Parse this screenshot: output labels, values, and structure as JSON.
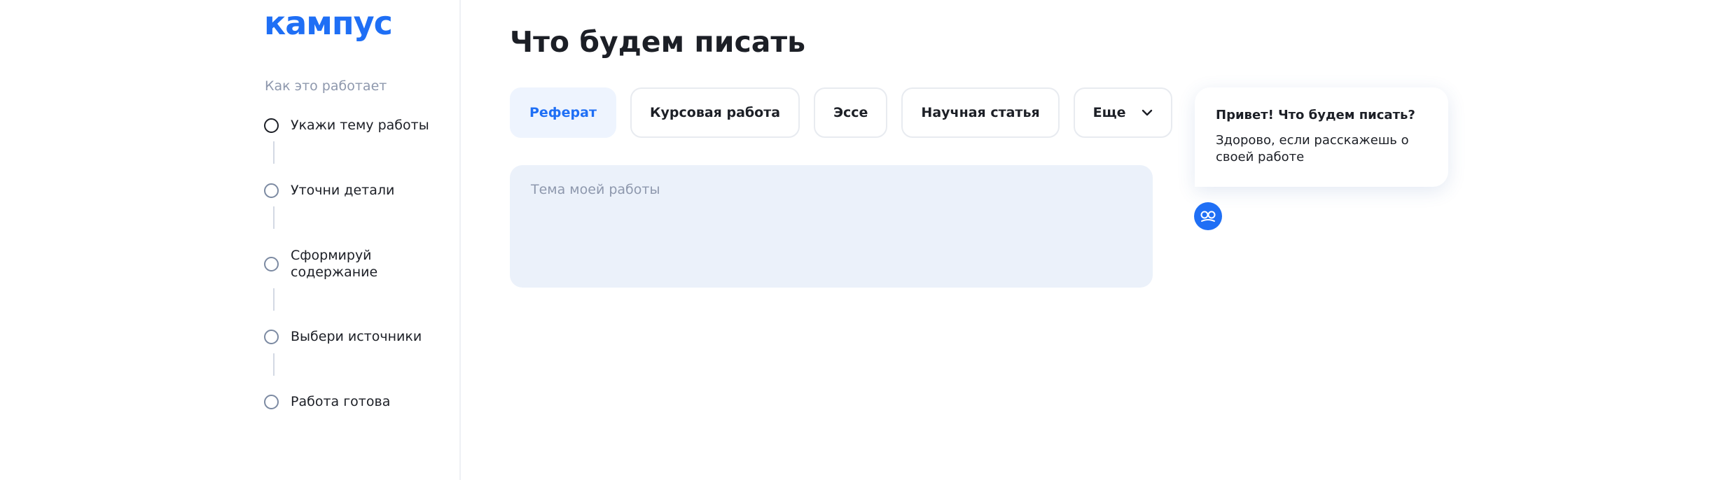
{
  "brand": {
    "logo_text": "кампус",
    "color": "#1f6ff5"
  },
  "sidebar": {
    "how_it_works_title": "Как это работает",
    "steps": [
      {
        "label": "Укажи тему работы",
        "active": true
      },
      {
        "label": "Уточни детали",
        "active": false
      },
      {
        "label": "Сформируй содержание",
        "active": false
      },
      {
        "label": "Выбери источники",
        "active": false
      },
      {
        "label": "Работа готова",
        "active": false
      }
    ]
  },
  "main": {
    "title": "Что будем писать",
    "tabs": [
      {
        "label": "Реферат",
        "selected": true
      },
      {
        "label": "Курсовая работа",
        "selected": false
      },
      {
        "label": "Эссе",
        "selected": false
      },
      {
        "label": "Научная статья",
        "selected": false
      },
      {
        "label": "Еще",
        "selected": false,
        "icon": "chevron-down-icon"
      }
    ],
    "topic_input": {
      "placeholder": "Тема моей работы",
      "value": ""
    }
  },
  "assistant": {
    "bubble_title": "Привет! Что будем писать?",
    "bubble_text": "Здорово, если расскажешь о своей работе",
    "avatar_icon": "assistant-icon"
  }
}
